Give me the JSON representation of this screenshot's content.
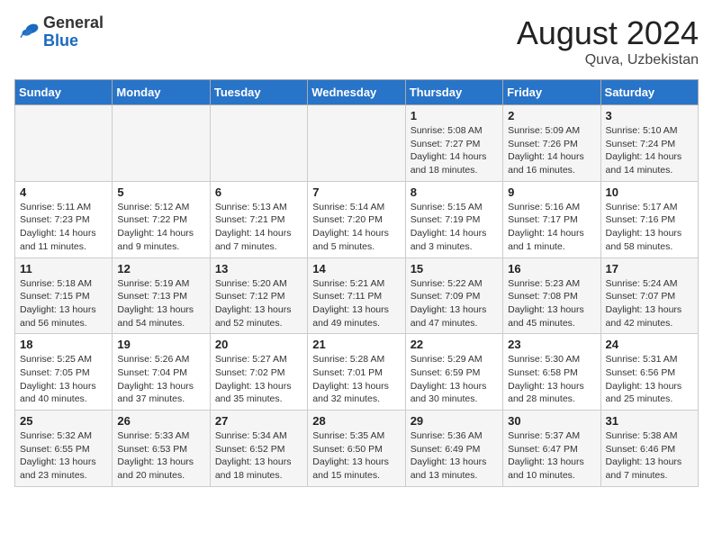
{
  "header": {
    "logo_general": "General",
    "logo_blue": "Blue",
    "month_year": "August 2024",
    "location": "Quva, Uzbekistan"
  },
  "weekdays": [
    "Sunday",
    "Monday",
    "Tuesday",
    "Wednesday",
    "Thursday",
    "Friday",
    "Saturday"
  ],
  "weeks": [
    [
      {
        "day": "",
        "info": ""
      },
      {
        "day": "",
        "info": ""
      },
      {
        "day": "",
        "info": ""
      },
      {
        "day": "",
        "info": ""
      },
      {
        "day": "1",
        "info": "Sunrise: 5:08 AM\nSunset: 7:27 PM\nDaylight: 14 hours\nand 18 minutes."
      },
      {
        "day": "2",
        "info": "Sunrise: 5:09 AM\nSunset: 7:26 PM\nDaylight: 14 hours\nand 16 minutes."
      },
      {
        "day": "3",
        "info": "Sunrise: 5:10 AM\nSunset: 7:24 PM\nDaylight: 14 hours\nand 14 minutes."
      }
    ],
    [
      {
        "day": "4",
        "info": "Sunrise: 5:11 AM\nSunset: 7:23 PM\nDaylight: 14 hours\nand 11 minutes."
      },
      {
        "day": "5",
        "info": "Sunrise: 5:12 AM\nSunset: 7:22 PM\nDaylight: 14 hours\nand 9 minutes."
      },
      {
        "day": "6",
        "info": "Sunrise: 5:13 AM\nSunset: 7:21 PM\nDaylight: 14 hours\nand 7 minutes."
      },
      {
        "day": "7",
        "info": "Sunrise: 5:14 AM\nSunset: 7:20 PM\nDaylight: 14 hours\nand 5 minutes."
      },
      {
        "day": "8",
        "info": "Sunrise: 5:15 AM\nSunset: 7:19 PM\nDaylight: 14 hours\nand 3 minutes."
      },
      {
        "day": "9",
        "info": "Sunrise: 5:16 AM\nSunset: 7:17 PM\nDaylight: 14 hours\nand 1 minute."
      },
      {
        "day": "10",
        "info": "Sunrise: 5:17 AM\nSunset: 7:16 PM\nDaylight: 13 hours\nand 58 minutes."
      }
    ],
    [
      {
        "day": "11",
        "info": "Sunrise: 5:18 AM\nSunset: 7:15 PM\nDaylight: 13 hours\nand 56 minutes."
      },
      {
        "day": "12",
        "info": "Sunrise: 5:19 AM\nSunset: 7:13 PM\nDaylight: 13 hours\nand 54 minutes."
      },
      {
        "day": "13",
        "info": "Sunrise: 5:20 AM\nSunset: 7:12 PM\nDaylight: 13 hours\nand 52 minutes."
      },
      {
        "day": "14",
        "info": "Sunrise: 5:21 AM\nSunset: 7:11 PM\nDaylight: 13 hours\nand 49 minutes."
      },
      {
        "day": "15",
        "info": "Sunrise: 5:22 AM\nSunset: 7:09 PM\nDaylight: 13 hours\nand 47 minutes."
      },
      {
        "day": "16",
        "info": "Sunrise: 5:23 AM\nSunset: 7:08 PM\nDaylight: 13 hours\nand 45 minutes."
      },
      {
        "day": "17",
        "info": "Sunrise: 5:24 AM\nSunset: 7:07 PM\nDaylight: 13 hours\nand 42 minutes."
      }
    ],
    [
      {
        "day": "18",
        "info": "Sunrise: 5:25 AM\nSunset: 7:05 PM\nDaylight: 13 hours\nand 40 minutes."
      },
      {
        "day": "19",
        "info": "Sunrise: 5:26 AM\nSunset: 7:04 PM\nDaylight: 13 hours\nand 37 minutes."
      },
      {
        "day": "20",
        "info": "Sunrise: 5:27 AM\nSunset: 7:02 PM\nDaylight: 13 hours\nand 35 minutes."
      },
      {
        "day": "21",
        "info": "Sunrise: 5:28 AM\nSunset: 7:01 PM\nDaylight: 13 hours\nand 32 minutes."
      },
      {
        "day": "22",
        "info": "Sunrise: 5:29 AM\nSunset: 6:59 PM\nDaylight: 13 hours\nand 30 minutes."
      },
      {
        "day": "23",
        "info": "Sunrise: 5:30 AM\nSunset: 6:58 PM\nDaylight: 13 hours\nand 28 minutes."
      },
      {
        "day": "24",
        "info": "Sunrise: 5:31 AM\nSunset: 6:56 PM\nDaylight: 13 hours\nand 25 minutes."
      }
    ],
    [
      {
        "day": "25",
        "info": "Sunrise: 5:32 AM\nSunset: 6:55 PM\nDaylight: 13 hours\nand 23 minutes."
      },
      {
        "day": "26",
        "info": "Sunrise: 5:33 AM\nSunset: 6:53 PM\nDaylight: 13 hours\nand 20 minutes."
      },
      {
        "day": "27",
        "info": "Sunrise: 5:34 AM\nSunset: 6:52 PM\nDaylight: 13 hours\nand 18 minutes."
      },
      {
        "day": "28",
        "info": "Sunrise: 5:35 AM\nSunset: 6:50 PM\nDaylight: 13 hours\nand 15 minutes."
      },
      {
        "day": "29",
        "info": "Sunrise: 5:36 AM\nSunset: 6:49 PM\nDaylight: 13 hours\nand 13 minutes."
      },
      {
        "day": "30",
        "info": "Sunrise: 5:37 AM\nSunset: 6:47 PM\nDaylight: 13 hours\nand 10 minutes."
      },
      {
        "day": "31",
        "info": "Sunrise: 5:38 AM\nSunset: 6:46 PM\nDaylight: 13 hours\nand 7 minutes."
      }
    ]
  ]
}
